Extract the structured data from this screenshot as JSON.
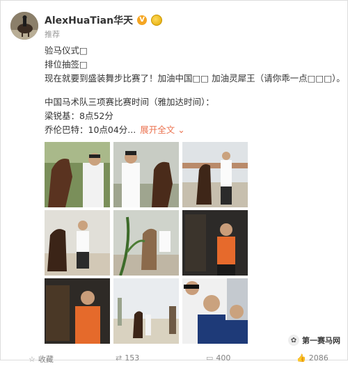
{
  "profile": {
    "username": "AlexHuaTian华天",
    "badge_icon": "verified-v-badge-icon",
    "medal_icon": "gold-medal-icon",
    "recommend_label": "推荐"
  },
  "post": {
    "lines": [
      "验马仪式□",
      "排位抽签□",
      "现在就要到盛装舞步比赛了！加油中国□□ 加油灵犀王（请你乖一点□□□）。"
    ],
    "schedule_title": "中国马术队三项赛比赛时间（雅加达时间）：",
    "schedule": [
      "梁锐基：8点52分",
      "乔伦巴特：10点04分..."
    ],
    "expand_label": "展开全文",
    "expand_icon": "chevron-down-icon"
  },
  "photos": [
    {
      "name": "photo-horse-and-rider-1"
    },
    {
      "name": "photo-rider-with-horse-2"
    },
    {
      "name": "photo-horse-walk-3"
    },
    {
      "name": "photo-horse-lead-4"
    },
    {
      "name": "photo-horse-leaf-5"
    },
    {
      "name": "photo-rider-stable-6"
    },
    {
      "name": "photo-grooming-7"
    },
    {
      "name": "photo-field-8"
    },
    {
      "name": "photo-team-selfie-9"
    }
  ],
  "actions": {
    "favorite_label": "收藏",
    "repost_count": "153",
    "comment_count": "400",
    "like_count": "2086"
  },
  "watermark": {
    "text": "第一赛马网"
  },
  "colors": {
    "accent": "#eb7350",
    "badge": "#f5a623"
  }
}
